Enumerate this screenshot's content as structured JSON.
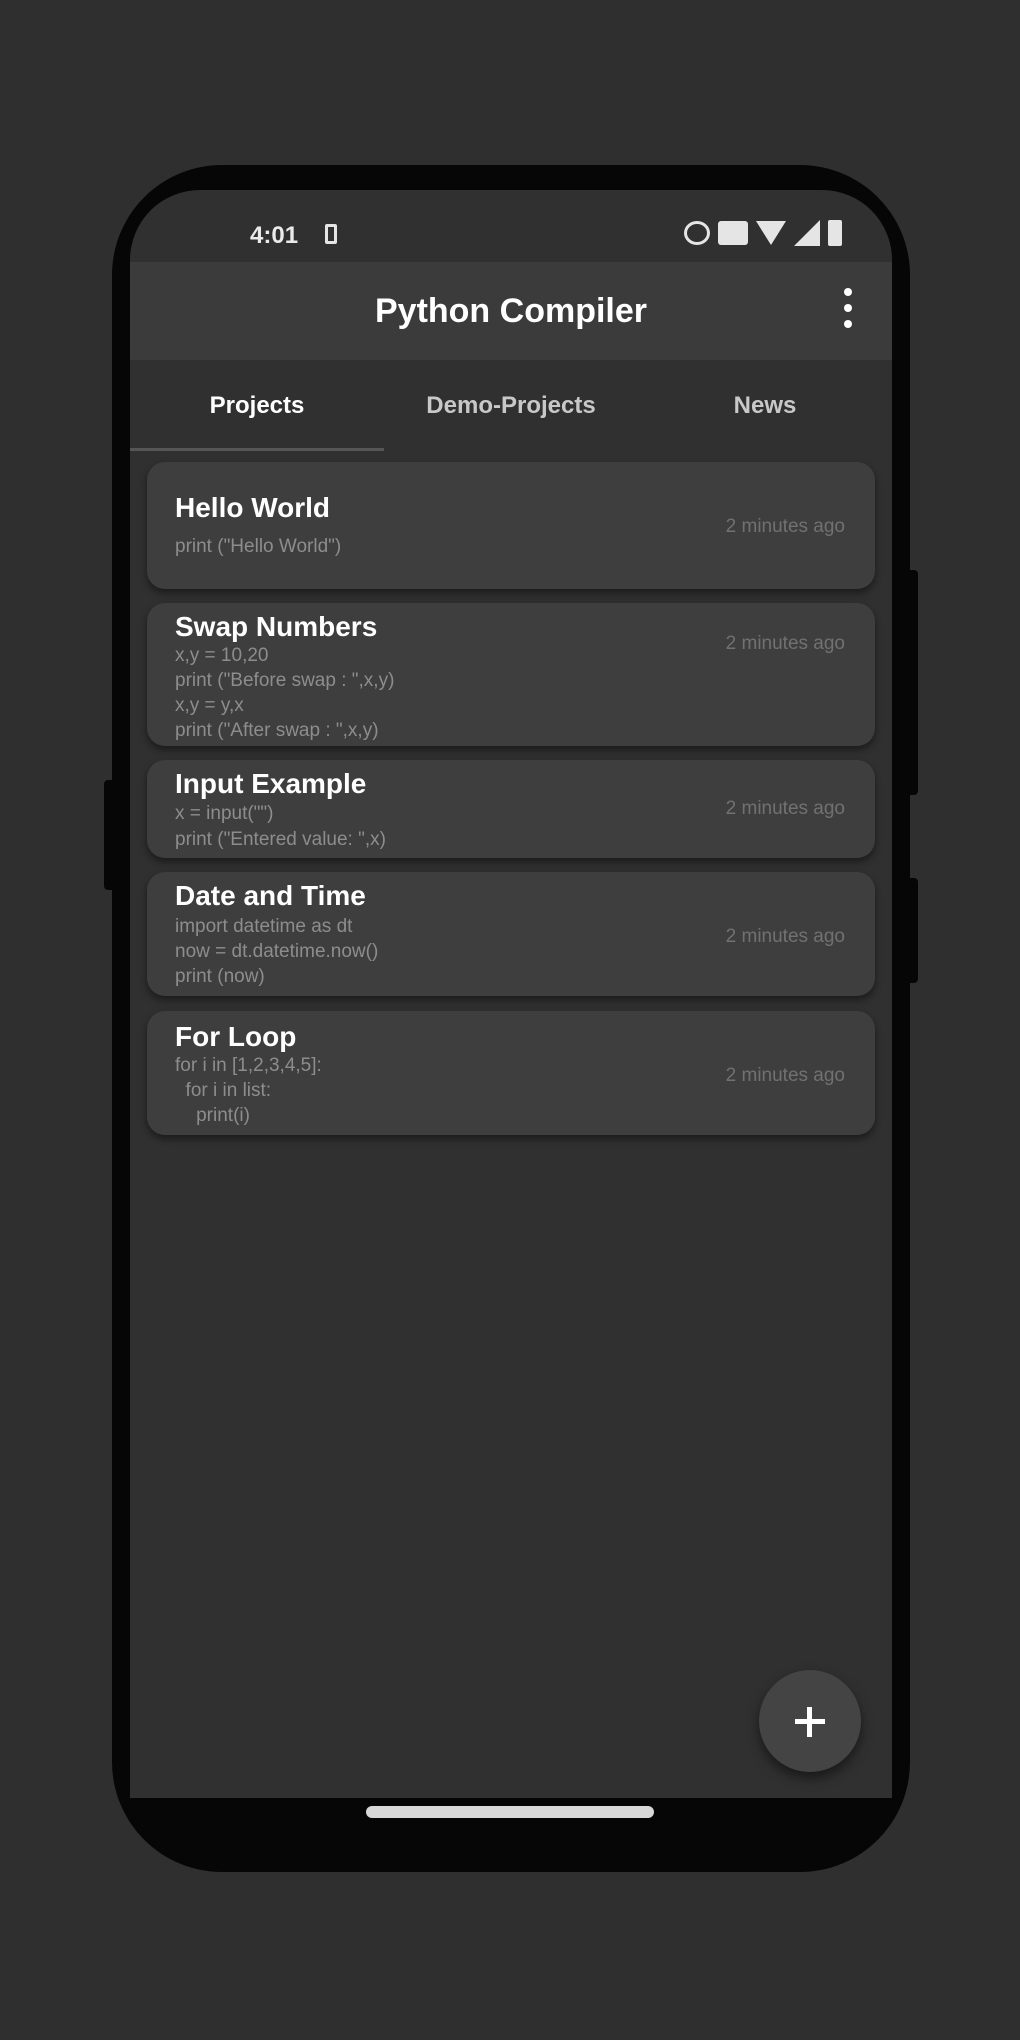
{
  "status_bar": {
    "time": "4:01",
    "icons": [
      "notification-icon",
      "cast-icon",
      "data-icon",
      "wifi-icon",
      "signal-icon",
      "battery-icon"
    ]
  },
  "app_bar": {
    "title": "Python Compiler",
    "menu_icon": "more-vert-icon"
  },
  "tabs": [
    {
      "label": "Projects",
      "selected": true
    },
    {
      "label": "Demo-Projects",
      "selected": false
    },
    {
      "label": "News",
      "selected": false
    }
  ],
  "projects": [
    {
      "title": "Hello World",
      "lines": [
        "print (\"Hello World\")"
      ],
      "time": "2 minutes ago"
    },
    {
      "title": "Swap Numbers",
      "lines": [
        "x,y = 10,20",
        "print (\"Before swap : \",x,y)",
        "x,y = y,x",
        "print (\"After swap : \",x,y)"
      ],
      "time": "2 minutes ago"
    },
    {
      "title": "Input Example",
      "lines": [
        "x = input(\"\")",
        "print (\"Entered value: \",x)"
      ],
      "time": "2 minutes ago"
    },
    {
      "title": "Date and Time",
      "lines": [
        "import datetime as dt",
        "now = dt.datetime.now()",
        "print (now)"
      ],
      "time": "2 minutes ago"
    },
    {
      "title": "For Loop",
      "lines": [
        "for i in [1,2,3,4,5]:",
        "  for i in list:",
        "    print(i)"
      ],
      "time": "2 minutes ago"
    }
  ],
  "fab": {
    "icon": "add-icon"
  },
  "colors": {
    "background": "#2f2f2f",
    "app_bar": "#3b3b3b",
    "card": "#3e3e3e",
    "fab": "#444444"
  }
}
